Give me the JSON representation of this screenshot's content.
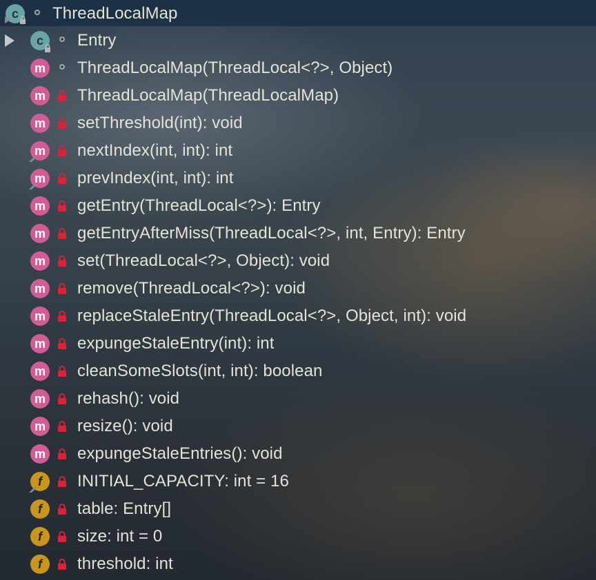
{
  "tree": {
    "root": {
      "icon": "class-icon",
      "label": "ThreadLocalMap"
    },
    "items": [
      {
        "kind": "class",
        "icon": "class-icon",
        "label": "Entry",
        "visibility": "package"
      },
      {
        "kind": "method",
        "icon": "method-icon",
        "label": "ThreadLocalMap(ThreadLocal<?>, Object)",
        "visibility": "package"
      },
      {
        "kind": "method",
        "icon": "method-icon",
        "label": "ThreadLocalMap(ThreadLocalMap)",
        "visibility": "private"
      },
      {
        "kind": "method",
        "icon": "method-icon",
        "label": "setThreshold(int): void",
        "visibility": "private"
      },
      {
        "kind": "method",
        "icon": "method-icon",
        "label": "nextIndex(int, int): int",
        "visibility": "private"
      },
      {
        "kind": "method",
        "icon": "method-icon",
        "label": "prevIndex(int, int): int",
        "visibility": "private"
      },
      {
        "kind": "method",
        "icon": "method-icon",
        "label": "getEntry(ThreadLocal<?>): Entry",
        "visibility": "private"
      },
      {
        "kind": "method",
        "icon": "method-icon",
        "label": "getEntryAfterMiss(ThreadLocal<?>, int, Entry): Entry",
        "visibility": "private"
      },
      {
        "kind": "method",
        "icon": "method-icon",
        "label": "set(ThreadLocal<?>, Object): void",
        "visibility": "private"
      },
      {
        "kind": "method",
        "icon": "method-icon",
        "label": "remove(ThreadLocal<?>): void",
        "visibility": "private"
      },
      {
        "kind": "method",
        "icon": "method-icon",
        "label": "replaceStaleEntry(ThreadLocal<?>, Object, int): void",
        "visibility": "private"
      },
      {
        "kind": "method",
        "icon": "method-icon",
        "label": "expungeStaleEntry(int): int",
        "visibility": "private"
      },
      {
        "kind": "method",
        "icon": "method-icon",
        "label": "cleanSomeSlots(int, int): boolean",
        "visibility": "private"
      },
      {
        "kind": "method",
        "icon": "method-icon",
        "label": "rehash(): void",
        "visibility": "private"
      },
      {
        "kind": "method",
        "icon": "method-icon",
        "label": "resize(): void",
        "visibility": "private"
      },
      {
        "kind": "method",
        "icon": "method-icon",
        "label": "expungeStaleEntries(): void",
        "visibility": "private"
      },
      {
        "kind": "field",
        "icon": "field-icon",
        "label": "INITIAL_CAPACITY: int = 16",
        "visibility": "private"
      },
      {
        "kind": "field",
        "icon": "field-icon",
        "label": "table: Entry[]",
        "visibility": "private"
      },
      {
        "kind": "field",
        "icon": "field-icon",
        "label": "size: int = 0",
        "visibility": "private"
      },
      {
        "kind": "field",
        "icon": "field-icon",
        "label": "threshold: int",
        "visibility": "private"
      }
    ]
  },
  "colors": {
    "method_icon": "#d35c96",
    "field_icon": "#c8961a",
    "class_icon": "#6aa5a6",
    "lock": "#d6243a",
    "text": "#e6e2d6",
    "header_bar": "#162c42"
  }
}
